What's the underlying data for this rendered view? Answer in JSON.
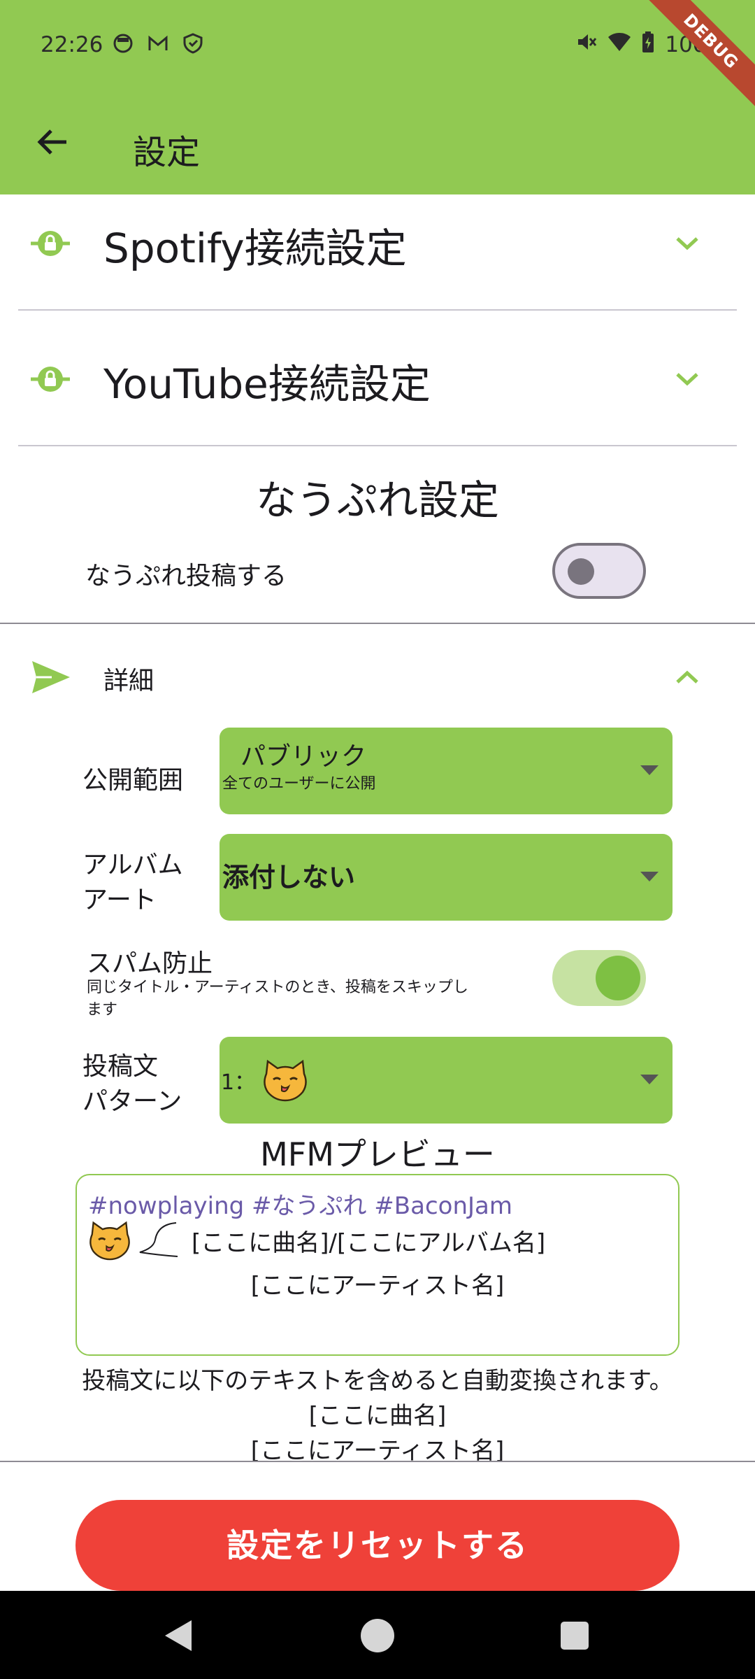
{
  "status_bar": {
    "time": "22:26",
    "battery": "100%",
    "debug_label": "DEBUG"
  },
  "app_bar": {
    "title": "設定"
  },
  "tiles": {
    "spotify": "Spotify接続設定",
    "youtube": "YouTube接続設定"
  },
  "nowplaying": {
    "section_title": "なうぷれ設定",
    "post_toggle_label": "なうぷれ投稿する",
    "post_toggle_on": false
  },
  "details": {
    "label": "詳細",
    "visibility_label": "公開範囲",
    "visibility_value": "パブリック",
    "visibility_desc": "全てのユーザーに公開",
    "album_art_label_1": "アルバム",
    "album_art_label_2": "アート",
    "album_art_value": "添付しない",
    "spam_label": "スパム防止",
    "spam_desc_1": "同じタイトル・アーティストのとき、投稿をスキップし",
    "spam_desc_2": "ます",
    "spam_on": true,
    "pattern_label_1": "投稿文",
    "pattern_label_2": "パターン",
    "pattern_value": "1："
  },
  "preview": {
    "title": "MFMプレビュー",
    "tags": "#nowplaying #なうぷれ #BaconJam",
    "line2": "[ここに曲名]/[ここにアルバム名]",
    "line3": "[ここにアーティスト名]"
  },
  "help": {
    "line1": "投稿文に以下のテキストを含めると自動変換されます。",
    "line2": "[ここに曲名]",
    "line3": "[ここにアーティスト名]"
  },
  "reset_button": "設定をリセットする",
  "colors": {
    "accent": "#91c952",
    "danger": "#ef4139",
    "tag": "#6a5aa8"
  }
}
